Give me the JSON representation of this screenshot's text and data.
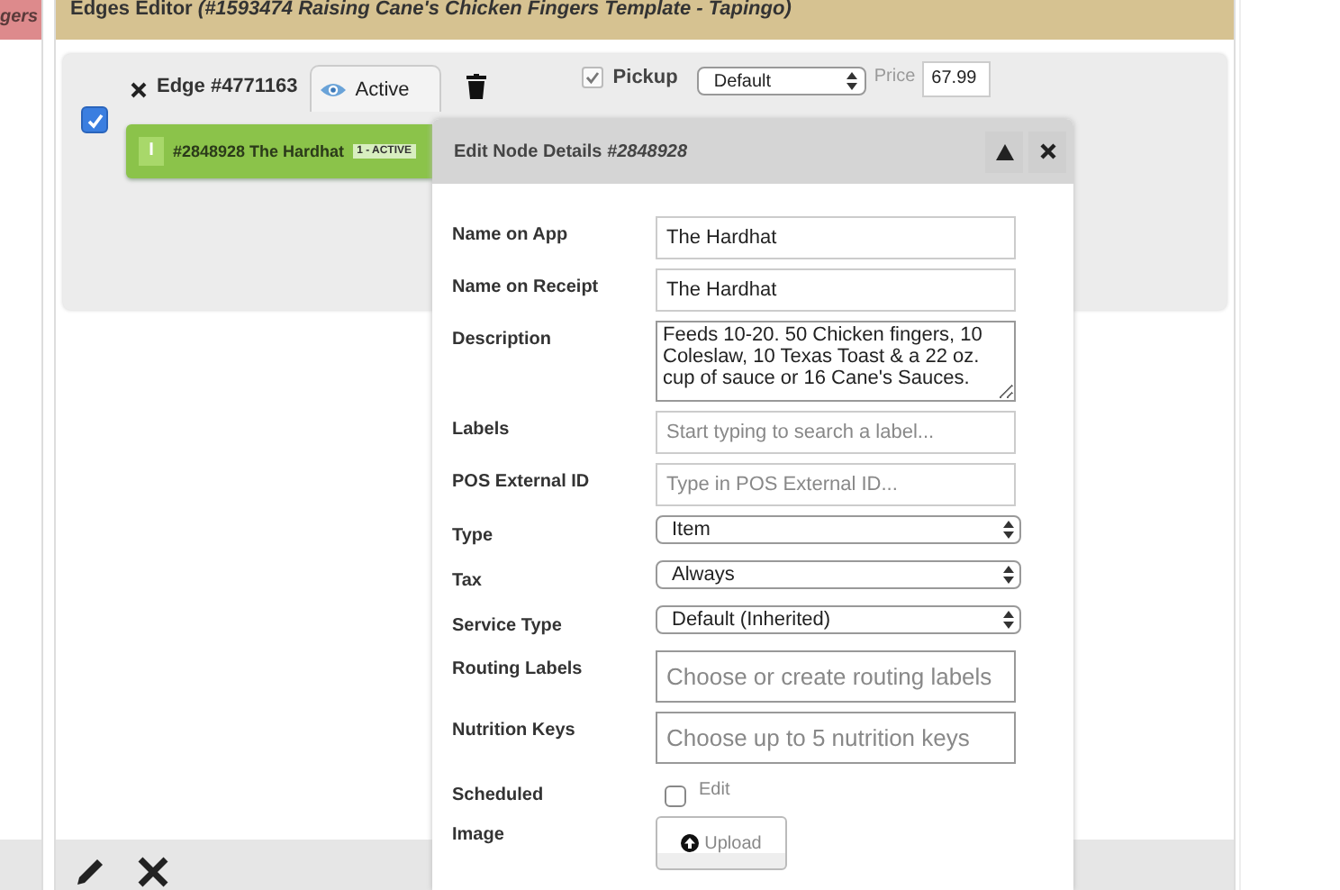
{
  "left_panel": {
    "title_fragment": "gers"
  },
  "editor": {
    "title": "Edges Editor *(#1593474 Raising Cane's Chicken Fingers Template - Tapingo)*",
    "edge": {
      "checked": true,
      "label": "Edge #4771163",
      "status": "Active",
      "pickup": {
        "label": "Pickup",
        "checked": true
      },
      "mode": "Default",
      "price_label": "Price",
      "price": "67.99",
      "node": {
        "badge": "I",
        "label": "#2848928 The Hardhat",
        "state": "1 - ACTIVE"
      }
    }
  },
  "modal": {
    "title": "Edit Node Details *#2848928*",
    "fields": [
      {
        "kind": "text",
        "label": "Name on App",
        "value": "The Hardhat"
      },
      {
        "kind": "text",
        "label": "Name on Receipt",
        "value": "The Hardhat"
      },
      {
        "kind": "textarea",
        "label": "Description",
        "value": "Feeds 10-20. 50 Chicken fingers, 10 Coleslaw, 10 Texas Toast & a 22 oz. cup of sauce or 16 Cane's Sauces."
      },
      {
        "kind": "text",
        "label": "Labels",
        "placeholder": "Start typing to search a label..."
      },
      {
        "kind": "text",
        "label": "POS External ID",
        "placeholder": "Type in POS External ID..."
      },
      {
        "kind": "select",
        "label": "Type",
        "value": "Item"
      },
      {
        "kind": "select",
        "label": "Tax",
        "value": "Always"
      },
      {
        "kind": "select",
        "label": "Service Type",
        "value": "Default (Inherited)"
      },
      {
        "kind": "tags",
        "label": "Routing Labels",
        "placeholder": "Choose or create routing labels"
      },
      {
        "kind": "tags",
        "label": "Nutrition Keys",
        "placeholder": "Choose up to 5 nutrition keys"
      },
      {
        "kind": "checkbox",
        "label": "Scheduled",
        "checked": false,
        "text": "Edit"
      },
      {
        "kind": "upload",
        "label": "Image",
        "text": "Upload"
      }
    ]
  }
}
